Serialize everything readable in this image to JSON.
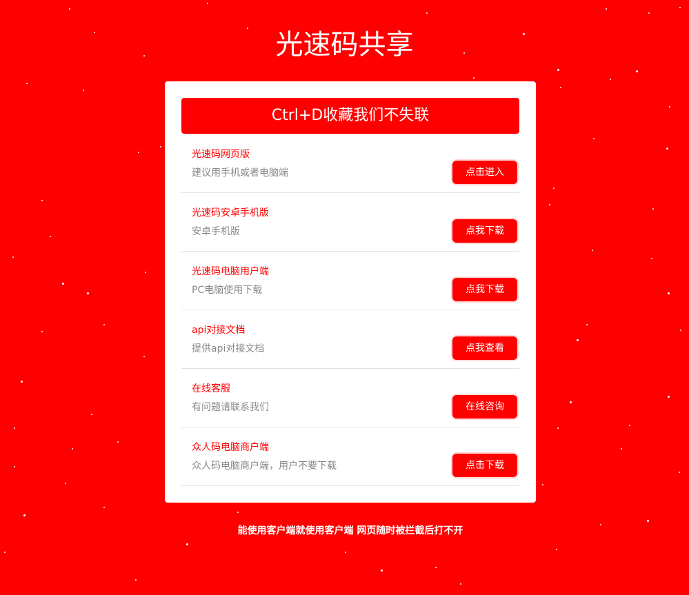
{
  "header": {
    "title": "光速码共享"
  },
  "card": {
    "banner": "Ctrl+D收藏我们不失联",
    "items": [
      {
        "title": "光速码网页版",
        "desc": "建议用手机或者电脑端",
        "button": "点击进入"
      },
      {
        "title": "光速码安卓手机版",
        "desc": "安卓手机版",
        "button": "点我下载"
      },
      {
        "title": "光速码电脑用户端",
        "desc": "PC电脑使用下载",
        "button": "点我下载"
      },
      {
        "title": "api对接文档",
        "desc": "提供api对接文档",
        "button": "点我查看"
      },
      {
        "title": "在线客服",
        "desc": "有问题请联系我们",
        "button": "在线咨询"
      },
      {
        "title": "众人码电脑商户端",
        "desc": "众人码电脑商户端，用户不要下载",
        "button": "点击下载"
      }
    ]
  },
  "footer": {
    "note": "能使用客户端就使用客户端 网页随时被拦截后打不开"
  },
  "colors": {
    "background": "#ff0000",
    "accent": "#ff0000",
    "card": "#ffffff",
    "muted_text": "#888888"
  }
}
